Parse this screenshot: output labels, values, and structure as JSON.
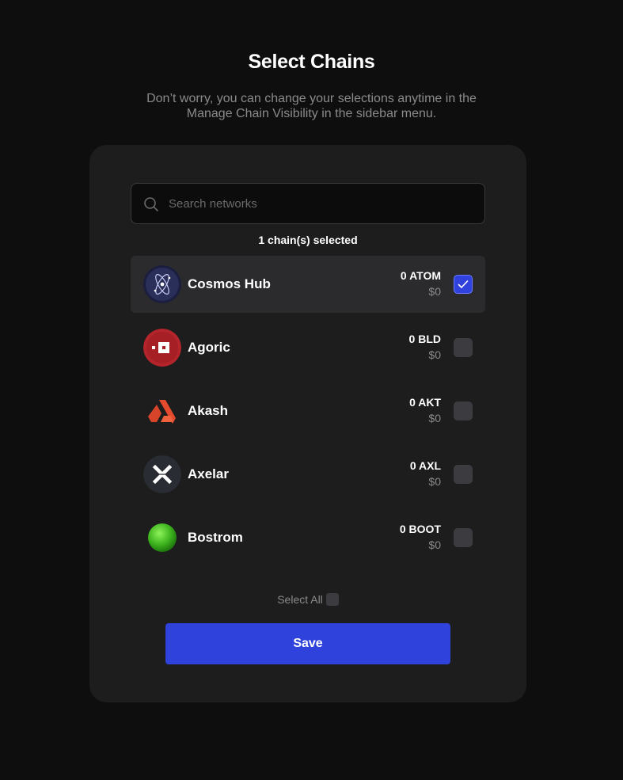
{
  "header": {
    "title": "Select Chains",
    "subtitle_line1": "Don’t worry, you can change your selections anytime in the",
    "subtitle_line2": "Manage Chain Visibility in the sidebar menu."
  },
  "search": {
    "placeholder": "Search networks",
    "value": "",
    "icon": "search-icon"
  },
  "selected_count": "1 chain(s) selected",
  "chains": [
    {
      "name": "Cosmos Hub",
      "amount": "0 ATOM",
      "usd": "$0",
      "checked": true,
      "icon": "cosmos-hub-logo-icon"
    },
    {
      "name": "Agoric",
      "amount": "0 BLD",
      "usd": "$0",
      "checked": false,
      "icon": "agoric-logo-icon"
    },
    {
      "name": "Akash",
      "amount": "0 AKT",
      "usd": "$0",
      "checked": false,
      "icon": "akash-logo-icon"
    },
    {
      "name": "Axelar",
      "amount": "0 AXL",
      "usd": "$0",
      "checked": false,
      "icon": "axelar-logo-icon"
    },
    {
      "name": "Bostrom",
      "amount": "0 BOOT",
      "usd": "$0",
      "checked": false,
      "icon": "bostrom-logo-icon"
    }
  ],
  "select_all_label": "Select All",
  "save_label": "Save",
  "colors": {
    "background": "#0e0e0e",
    "card": "#1d1d1d",
    "accent": "#2f42db",
    "muted_text": "#8a8a8a"
  }
}
